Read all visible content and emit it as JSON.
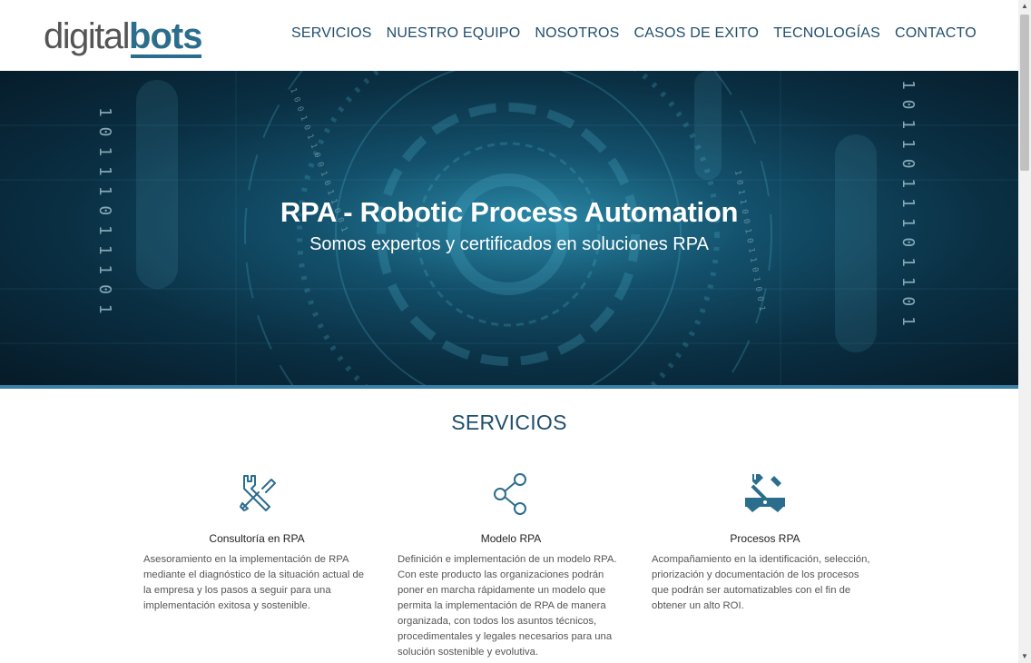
{
  "logo": {
    "part1": "digital",
    "part2": "bots"
  },
  "nav": [
    "SERVICIOS",
    "NUESTRO EQUIPO",
    "NOSOTROS",
    "CASOS DE EXITO",
    "TECNOLOGÍAS",
    "CONTACTO"
  ],
  "hero": {
    "title": "RPA - Robotic Process Automation",
    "subtitle": "Somos expertos y certificados en soluciones RPA"
  },
  "services": {
    "heading": "SERVICIOS",
    "items": [
      {
        "icon": "tools-icon",
        "name": "Consultoría en RPA",
        "desc": "Asesoramiento en la implementación de RPA mediante el diagnóstico de la situación actual de la empresa y los pasos a seguir para una implementación exitosa y sostenible."
      },
      {
        "icon": "share-icon",
        "name": "Modelo RPA",
        "desc": "Definición e implementación de un modelo RPA. Con este producto las organizaciones podrán poner en marcha rápidamente un modelo que permita la implementación de RPA de manera organizada, con todos los asuntos técnicos, procedimentales y legales necesarios para una solución sostenible y evolutiva."
      },
      {
        "icon": "wrench-icon",
        "name": "Procesos RPA",
        "desc": "Acompañamiento en la identificación, selección, priorización y documentación de los procesos que podrán ser automatizables con el fin de obtener un alto ROI."
      }
    ]
  },
  "colors": {
    "accent": "#1f4e6c",
    "brand": "#2b6d8c"
  }
}
